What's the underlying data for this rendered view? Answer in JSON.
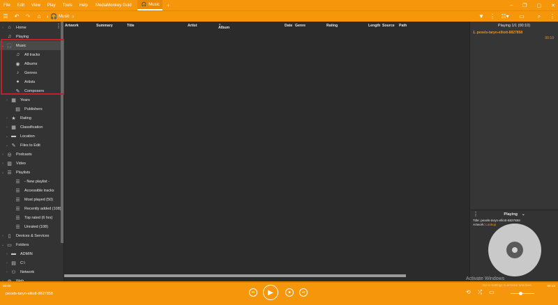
{
  "menu": [
    "File",
    "Edit",
    "View",
    "Play",
    "Tools",
    "Help"
  ],
  "app_title": "MediaMonkey Gold",
  "tab": {
    "label": "Music",
    "add": "+"
  },
  "window_controls": {
    "minimize": "–",
    "restore": "▢",
    "maximize": "❐",
    "close": "✕"
  },
  "breadcrumb": "Music",
  "sidebar": {
    "items": [
      {
        "label": "Home",
        "icon": "home-icon",
        "glyph": "⌂"
      },
      {
        "label": "Playing",
        "icon": "music-note-icon",
        "glyph": "♫"
      },
      {
        "label": "Music",
        "icon": "headphones-icon",
        "glyph": "🎧"
      },
      {
        "label": "All tracks",
        "icon": "music-note-icon",
        "glyph": "♫"
      },
      {
        "label": "Albums",
        "icon": "disc-icon",
        "glyph": "◉"
      },
      {
        "label": "Genres",
        "icon": "guitar-icon",
        "glyph": "♪"
      },
      {
        "label": "Artists",
        "icon": "person-icon",
        "glyph": "●"
      },
      {
        "label": "Composers",
        "icon": "pen-icon",
        "glyph": "✎"
      },
      {
        "label": "Years",
        "icon": "calendar-icon",
        "glyph": "▦"
      },
      {
        "label": "Publishers",
        "icon": "publisher-icon",
        "glyph": "▤"
      },
      {
        "label": "Rating",
        "icon": "star-icon",
        "glyph": "★"
      },
      {
        "label": "Classification",
        "icon": "grid-icon",
        "glyph": "▦"
      },
      {
        "label": "Location",
        "icon": "folder-icon",
        "glyph": "▬"
      },
      {
        "label": "Files to Edit",
        "icon": "pencil-icon",
        "glyph": "✎"
      },
      {
        "label": "Podcasts",
        "icon": "podcast-icon",
        "glyph": "◎"
      },
      {
        "label": "Video",
        "icon": "film-icon",
        "glyph": "▥"
      },
      {
        "label": "Playlists",
        "icon": "list-icon",
        "glyph": "☰"
      },
      {
        "label": "- New playlist -",
        "icon": "list-icon",
        "glyph": "☰"
      },
      {
        "label": "Accessible tracks",
        "icon": "list-icon",
        "glyph": "☰"
      },
      {
        "label": "Most played (50)",
        "icon": "list-icon",
        "glyph": "☰"
      },
      {
        "label": "Recently added (108)",
        "icon": "list-icon",
        "glyph": "☰"
      },
      {
        "label": "Top rated (6 hrs)",
        "icon": "list-icon",
        "glyph": "☰"
      },
      {
        "label": "Unrated (108)",
        "icon": "list-icon",
        "glyph": "☰"
      },
      {
        "label": "Devices & Services",
        "icon": "device-icon",
        "glyph": "▯"
      },
      {
        "label": "Folders",
        "icon": "computer-icon",
        "glyph": "▭"
      },
      {
        "label": "ADMIN",
        "icon": "folder-icon",
        "glyph": "▬"
      },
      {
        "label": "C:\\",
        "icon": "drive-icon",
        "glyph": "▤"
      },
      {
        "label": "Network",
        "icon": "network-icon",
        "glyph": "⚇"
      },
      {
        "label": "Web",
        "icon": "globe-icon",
        "glyph": "◍"
      }
    ]
  },
  "columns": [
    "Artwork",
    "Summary",
    "Title",
    "Artist",
    "Album",
    "Date",
    "Genre",
    "Rating",
    "Length",
    "Source",
    "Path"
  ],
  "now_playing_list": {
    "header": "Playing 1/1 (00:10)",
    "item": "1. pexels-taryn-elliott-8827858",
    "item_time": "00:10"
  },
  "playing_panel": {
    "header": "Playing",
    "title_label": "Title:",
    "title_value": "pexels-taryn-elliott-8827858",
    "artwork_label": "Artwork:",
    "artwork_value": "Lookup"
  },
  "player": {
    "time_elapsed": "00:00",
    "time_total": "00:10",
    "track": "pexels-taryn-elliott-8827858",
    "watermark_line1": "Activate Windows",
    "watermark_line2": "Go to Settings to activate Windows."
  }
}
